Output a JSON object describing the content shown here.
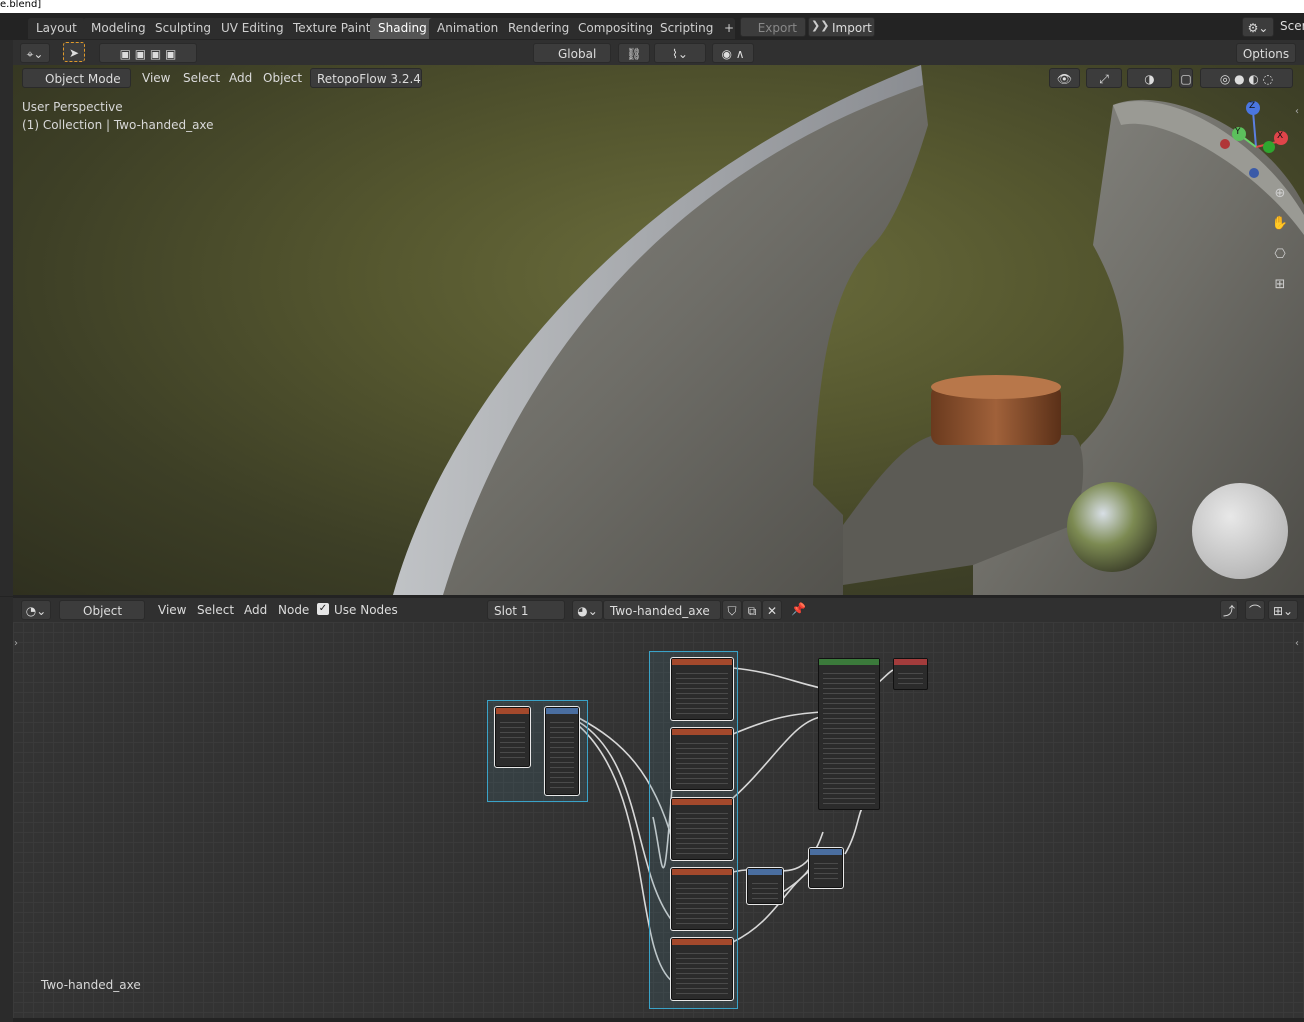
{
  "window": {
    "title_fragment": "e.blend]"
  },
  "workspace_tabs": [
    "Layout",
    "Modeling",
    "Sculpting",
    "UV Editing",
    "Texture Paint",
    "Shading",
    "Animation",
    "Rendering",
    "Compositing",
    "Scripting"
  ],
  "active_tab": "Shading",
  "topbar_right": {
    "export_label": "Export",
    "import_label": "Import",
    "scene_label": "Scer"
  },
  "viewport_header": {
    "transform_orientation": "Global",
    "options_label": "Options",
    "mode_label": "Object Mode",
    "menus": [
      "View",
      "Select",
      "Add",
      "Object"
    ],
    "addon_label": "RetopoFlow 3.2.4"
  },
  "viewport_overlay": {
    "perspective": "User Perspective",
    "collection_info": "(1) Collection | Two-handed_axe"
  },
  "gizmo": {
    "z": "Z",
    "y": "Y",
    "x": "X"
  },
  "node_editor_header": {
    "type_label": "Object",
    "menus": [
      "View",
      "Select",
      "Add",
      "Node"
    ],
    "use_nodes_label": "Use Nodes",
    "use_nodes_checked": true,
    "slot_label": "Slot 1",
    "material_name": "Two-handed_axe"
  },
  "node_editor_footer": {
    "material_name": "Two-handed_axe"
  },
  "colors": {
    "accent_tab": "#545454",
    "frame": "#3aa3c8",
    "texture_node_header": "#a4492c",
    "bsdf_header": "#3b7a3b",
    "output_header": "#a33c3c",
    "vector_header": "#4a6ea0"
  }
}
